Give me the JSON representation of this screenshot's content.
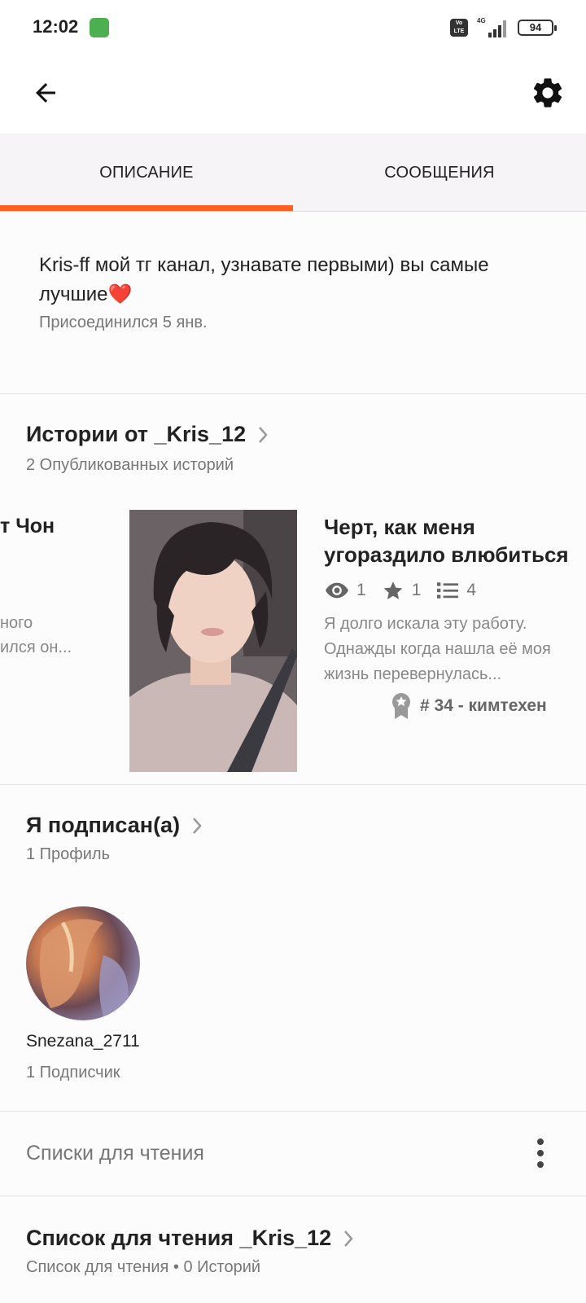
{
  "status_bar": {
    "time": "12:02",
    "volte": "Vo LTE",
    "network": "4G",
    "battery": "94"
  },
  "colors": {
    "accent": "#ff6122",
    "text_primary": "#222222",
    "text_secondary": "#777777"
  },
  "tabs": [
    {
      "label": "ОПИСАНИЕ",
      "active": true
    },
    {
      "label": "СООБЩЕНИЯ",
      "active": false
    }
  ],
  "profile": {
    "bio": "Kris-ff мой тг канал, узнавате первыми) вы самые лучшие",
    "bio_emoji": "❤️",
    "joined": "Присоединился 5 янв."
  },
  "stories_section": {
    "title": "Истории от _Kris_12",
    "subtitle": "2 Опубликованных историй",
    "prev_story": {
      "title_fragment": "т Чон",
      "desc_fragment": "ного\nился он..."
    },
    "story": {
      "title": "Черт, как меня угораздило влюбиться",
      "views": "1",
      "votes": "1",
      "parts": "4",
      "description": "Я долго искала эту работу. Однажды когда нашла её моя жизнь перевернулась...",
      "rank": "# 34 - кимтехен"
    }
  },
  "following_section": {
    "title": "Я подписан(а)",
    "subtitle": "1 Профиль",
    "profile": {
      "name": "Snezana_2711",
      "followers": "1 Подписчик"
    }
  },
  "reading_lists": {
    "label": "Списки для чтения",
    "list": {
      "title": "Список для чтения _Kris_12",
      "subtitle": "Список для чтения • 0 Историй"
    }
  },
  "icons": [
    "back-arrow-icon",
    "gear-icon",
    "chevron-right-icon",
    "eye-icon",
    "star-icon",
    "list-icon",
    "award-icon",
    "more-vertical-icon"
  ]
}
